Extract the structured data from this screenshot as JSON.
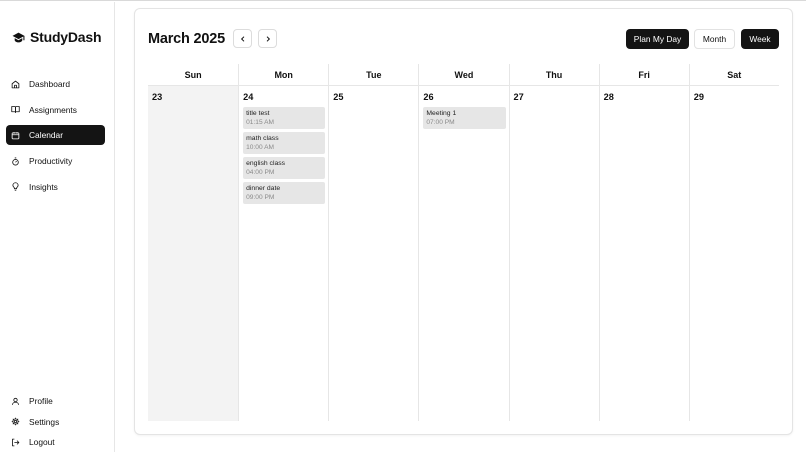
{
  "app": {
    "name": "StudyDash"
  },
  "nav": [
    {
      "label": "Dashboard",
      "icon": "home-icon",
      "active": false
    },
    {
      "label": "Assignments",
      "icon": "book-icon",
      "active": false
    },
    {
      "label": "Calendar",
      "icon": "calendar-icon",
      "active": true
    },
    {
      "label": "Productivity",
      "icon": "timer-icon",
      "active": false
    },
    {
      "label": "Insights",
      "icon": "lightbulb-icon",
      "active": false
    }
  ],
  "bottom_nav": [
    {
      "label": "Profile",
      "icon": "user-icon"
    },
    {
      "label": "Settings",
      "icon": "gear-icon"
    },
    {
      "label": "Logout",
      "icon": "logout-icon"
    }
  ],
  "calendar": {
    "title": "March 2025",
    "prev_icon": "chevron-left-icon",
    "next_icon": "chevron-right-icon",
    "plan_label": "Plan My Day",
    "month_label": "Month",
    "week_label": "Week",
    "active_view": "Week",
    "weekdays": [
      "Sun",
      "Mon",
      "Tue",
      "Wed",
      "Thu",
      "Fri",
      "Sat"
    ],
    "days": [
      {
        "num": "23",
        "muted": true,
        "events": []
      },
      {
        "num": "24",
        "muted": false,
        "events": [
          {
            "title": "title test",
            "time": "01:15 AM"
          },
          {
            "title": "math class",
            "time": "10:00 AM"
          },
          {
            "title": "english class",
            "time": "04:00 PM"
          },
          {
            "title": "dinner date",
            "time": "09:00 PM"
          }
        ]
      },
      {
        "num": "25",
        "muted": false,
        "events": []
      },
      {
        "num": "26",
        "muted": false,
        "events": [
          {
            "title": "Meeting 1",
            "time": "07:00 PM"
          }
        ]
      },
      {
        "num": "27",
        "muted": false,
        "events": []
      },
      {
        "num": "28",
        "muted": false,
        "events": []
      },
      {
        "num": "29",
        "muted": false,
        "events": []
      }
    ]
  },
  "colors": {
    "accent": "#141414",
    "muted_day": "#f3f3f3",
    "event_bg": "#e6e6e6",
    "border": "#e6e6e6"
  }
}
